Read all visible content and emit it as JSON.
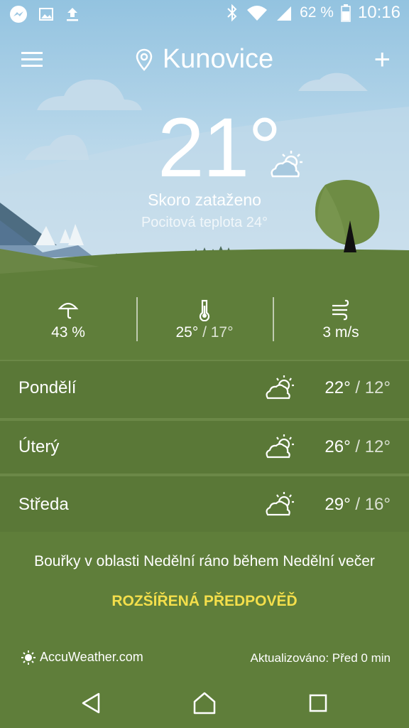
{
  "status_bar": {
    "battery": "62 %",
    "time": "10:16",
    "left_icons": [
      "messenger-icon",
      "gallery-icon",
      "upload-icon"
    ],
    "right_icons": [
      "bluetooth-icon",
      "wifi-icon",
      "signal-icon",
      "battery-icon"
    ]
  },
  "header": {
    "location": "Kunovice",
    "menu_icon": "menu-icon",
    "add_icon": "add-icon",
    "add_label": "+"
  },
  "current": {
    "temperature": "21°",
    "condition": "Skoro zataženo",
    "feels_like": "Pocitová teplota 24°",
    "icon": "partly-cloudy-icon"
  },
  "stats": {
    "precip": "43 %",
    "high": "25°",
    "low": " / 17°",
    "wind": "3 m/s"
  },
  "forecast": [
    {
      "day": "Pondělí",
      "high": "22°",
      "low": " / 12°",
      "icon": "partly-cloudy-icon"
    },
    {
      "day": "Úterý",
      "high": "26°",
      "low": " / 12°",
      "icon": "partly-cloudy-icon"
    },
    {
      "day": "Středa",
      "high": "29°",
      "low": " / 16°",
      "icon": "partly-cloudy-icon"
    }
  ],
  "alert": "Bouřky v oblasti Nedělní ráno během Nedělní večer",
  "extended_label": "ROZŠÍŘENÁ PŘEDPOVĚĎ",
  "footer": {
    "brand": "AccuWeather.com",
    "updated": "Aktualizováno: Před 0 min"
  },
  "colors": {
    "sky_top": "#a9cfe6",
    "sky_bottom": "#d7e8f2",
    "grass": "#5f7e3a",
    "accent": "#f4df4b"
  }
}
